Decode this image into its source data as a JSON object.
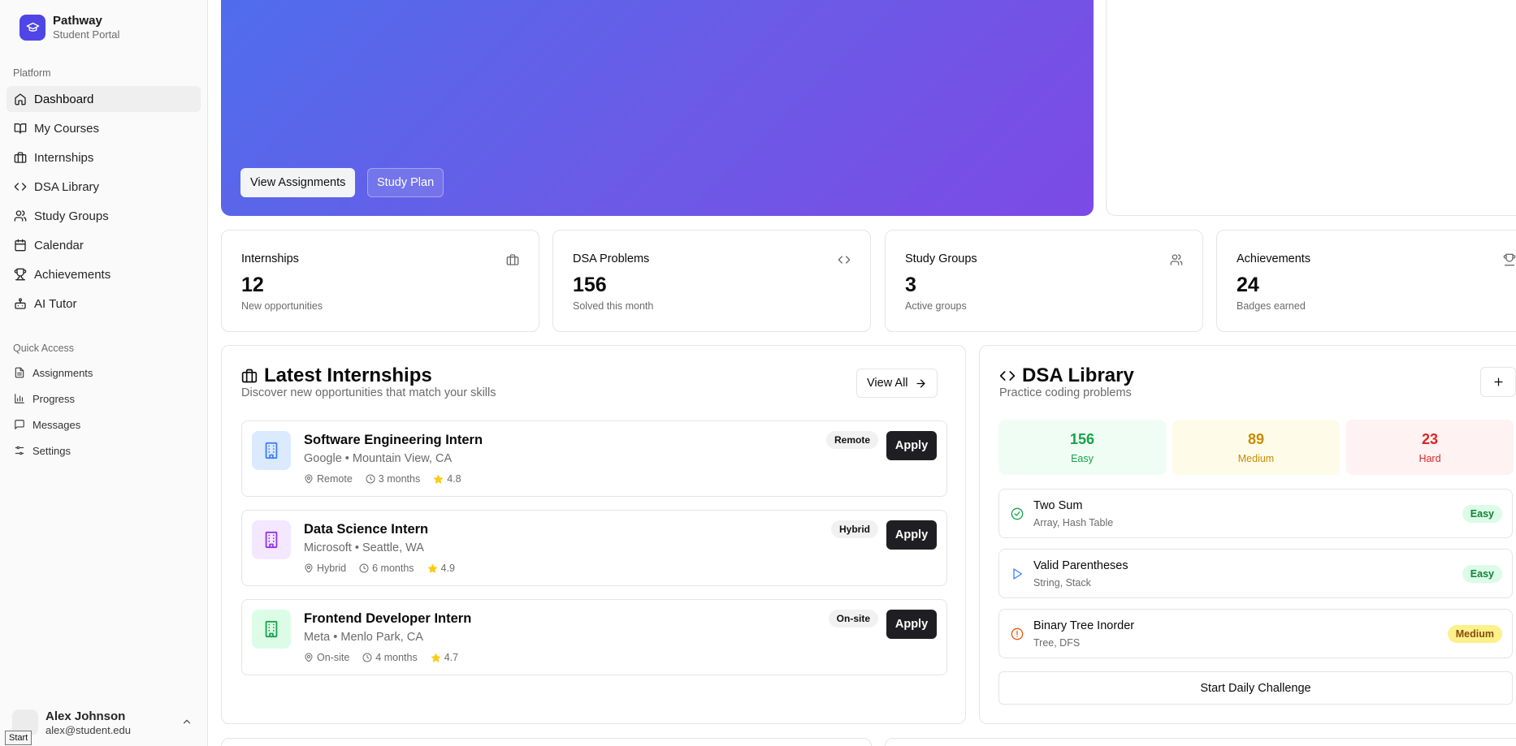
{
  "brand": {
    "name": "Pathway",
    "subtitle": "Student Portal"
  },
  "sidebar": {
    "platform_label": "Platform",
    "items": [
      {
        "label": "Dashboard",
        "icon": "home-icon"
      },
      {
        "label": "My Courses",
        "icon": "book-icon"
      },
      {
        "label": "Internships",
        "icon": "briefcase-icon"
      },
      {
        "label": "DSA Library",
        "icon": "code-icon"
      },
      {
        "label": "Study Groups",
        "icon": "users-icon"
      },
      {
        "label": "Calendar",
        "icon": "calendar-icon"
      },
      {
        "label": "Achievements",
        "icon": "trophy-icon"
      },
      {
        "label": "AI Tutor",
        "icon": "bot-icon"
      }
    ],
    "quick_access_label": "Quick Access",
    "quick_items": [
      {
        "label": "Assignments",
        "icon": "file-icon"
      },
      {
        "label": "Progress",
        "icon": "chart-icon"
      },
      {
        "label": "Messages",
        "icon": "message-icon"
      },
      {
        "label": "Settings",
        "icon": "settings-icon"
      }
    ]
  },
  "user": {
    "name": "Alex Johnson",
    "email": "alex@student.edu"
  },
  "tooltip": "Start",
  "hero": {
    "primary_button": "View Assignments",
    "secondary_button": "Study Plan"
  },
  "stats": [
    {
      "title": "Internships",
      "value": "12",
      "sub": "New opportunities",
      "icon": "briefcase-icon"
    },
    {
      "title": "DSA Problems",
      "value": "156",
      "sub": "Solved this month",
      "icon": "code-icon"
    },
    {
      "title": "Study Groups",
      "value": "3",
      "sub": "Active groups",
      "icon": "users-icon"
    },
    {
      "title": "Achievements",
      "value": "24",
      "sub": "Badges earned",
      "icon": "trophy-icon"
    }
  ],
  "internships_panel": {
    "title": "Latest Internships",
    "subtitle": "Discover new opportunities that match your skills",
    "view_all": "View All",
    "apply_label": "Apply",
    "items": [
      {
        "title": "Software Engineering Intern",
        "company": "Google • Mountain View, CA",
        "badge": "Remote",
        "location": "Remote",
        "duration": "3 months",
        "rating": "4.8",
        "color": "#3b82f6"
      },
      {
        "title": "Data Science Intern",
        "company": "Microsoft • Seattle, WA",
        "badge": "Hybrid",
        "location": "Hybrid",
        "duration": "6 months",
        "rating": "4.9",
        "color": "#9333ea"
      },
      {
        "title": "Frontend Developer Intern",
        "company": "Meta • Menlo Park, CA",
        "badge": "On-site",
        "location": "On-site",
        "duration": "4 months",
        "rating": "4.7",
        "color": "#16a34a"
      }
    ]
  },
  "dsa_panel": {
    "title": "DSA Library",
    "subtitle": "Practice coding problems",
    "counts": [
      {
        "value": "156",
        "label": "Easy",
        "color": "#16a34a"
      },
      {
        "value": "89",
        "label": "Medium",
        "color": "#ca8a04"
      },
      {
        "value": "23",
        "label": "Hard",
        "color": "#dc2626"
      }
    ],
    "problems": [
      {
        "title": "Two Sum",
        "tags": "Array, Hash Table",
        "difficulty": "Easy",
        "status": "check-circle-icon"
      },
      {
        "title": "Valid Parentheses",
        "tags": "String, Stack",
        "difficulty": "Easy",
        "status": "play-icon"
      },
      {
        "title": "Binary Tree Inorder",
        "tags": "Tree, DFS",
        "difficulty": "Medium",
        "status": "alert-circle-icon"
      }
    ],
    "daily_button": "Start Daily Challenge"
  }
}
